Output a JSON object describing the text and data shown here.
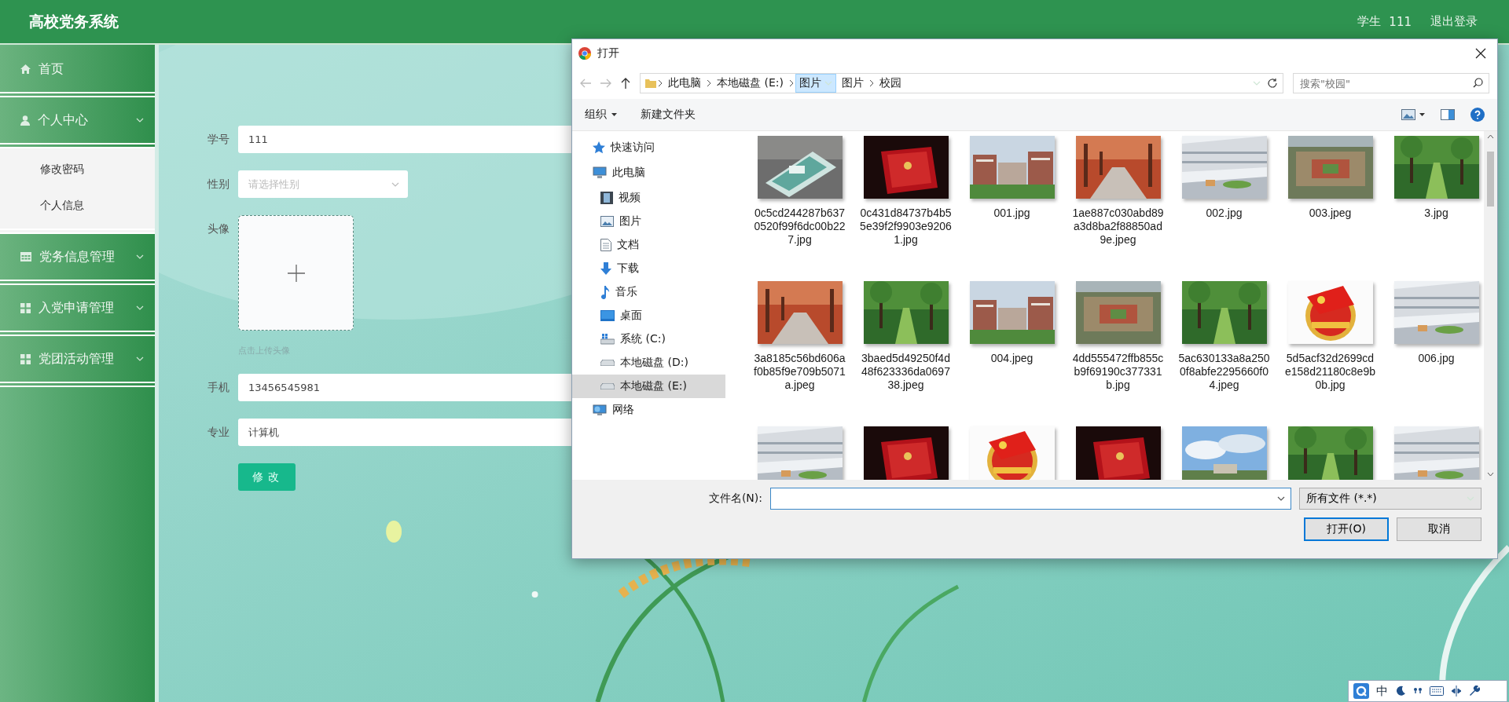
{
  "header": {
    "title": "高校党务系统",
    "role": "学生",
    "username": "111",
    "logout": "退出登录"
  },
  "sidebar": {
    "items": [
      {
        "label": "首页",
        "kind": "home"
      },
      {
        "label": "个人中心",
        "kind": "user",
        "expanded": true,
        "children": [
          {
            "label": "修改密码"
          },
          {
            "label": "个人信息"
          }
        ]
      },
      {
        "label": "党务信息管理",
        "kind": "table"
      },
      {
        "label": "入党申请管理",
        "kind": "grid"
      },
      {
        "label": "党团活动管理",
        "kind": "grid"
      }
    ]
  },
  "form": {
    "fields": [
      {
        "label": "学号",
        "kind": "text",
        "value": "111"
      },
      {
        "label": "性别",
        "kind": "select",
        "placeholder": "请选择性别"
      },
      {
        "label": "头像",
        "kind": "upload",
        "hint": "点击上传头像"
      },
      {
        "label": "手机",
        "kind": "text",
        "value": "13456545981"
      },
      {
        "label": "专业",
        "kind": "text",
        "value": "计算机"
      }
    ],
    "submit": "修改"
  },
  "dialog": {
    "title": "打开",
    "address": [
      {
        "label": "此电脑",
        "selected": false
      },
      {
        "label": "本地磁盘 (E:)",
        "selected": false
      },
      {
        "label": "图片",
        "selected": true
      },
      {
        "label": "图片",
        "selected": false
      },
      {
        "label": "校园",
        "selected": false
      }
    ],
    "search": {
      "placeholder": "搜索\"校园\""
    },
    "toolbar": {
      "organize": "组织",
      "new_folder": "新建文件夹"
    },
    "nav": [
      {
        "label": "快速访问",
        "kind": "star",
        "selected": false
      },
      {
        "label": "此电脑",
        "kind": "pc",
        "selected": false,
        "children": [
          {
            "label": "视频",
            "kind": "video",
            "selected": false
          },
          {
            "label": "图片",
            "kind": "pictures",
            "selected": false
          },
          {
            "label": "文档",
            "kind": "document",
            "selected": false
          },
          {
            "label": "下载",
            "kind": "download",
            "selected": false
          },
          {
            "label": "音乐",
            "kind": "music",
            "selected": false
          },
          {
            "label": "桌面",
            "kind": "desktop",
            "selected": false
          },
          {
            "label": "系统 (C:)",
            "kind": "system",
            "selected": false
          },
          {
            "label": "本地磁盘 (D:)",
            "kind": "drive",
            "selected": false
          },
          {
            "label": "本地磁盘 (E:)",
            "kind": "drive",
            "selected": true
          }
        ]
      },
      {
        "label": "网络",
        "kind": "network",
        "selected": false
      }
    ],
    "files": [
      {
        "name": "0c5cd244287b6370520f99f6dc00b227.jpg",
        "kind": "picture"
      },
      {
        "name": "0c431d84737b4b55e39f2f9903e92061.jpg",
        "kind": "picture"
      },
      {
        "name": "001.jpg",
        "kind": "picture"
      },
      {
        "name": "1ae887c030abd89a3d8ba2f88850ad9e.jpeg",
        "kind": "picture"
      },
      {
        "name": "002.jpg",
        "kind": "picture"
      },
      {
        "name": "003.jpeg",
        "kind": "picture"
      },
      {
        "name": "3.jpg",
        "kind": "picture"
      },
      {
        "name": "3a8185c56bd606af0b85f9e709b5071a.jpeg",
        "kind": "picture"
      },
      {
        "name": "3baed5d49250f4d48f623336da069738.jpeg",
        "kind": "picture"
      },
      {
        "name": "004.jpeg",
        "kind": "picture"
      },
      {
        "name": "4dd555472ffb855cb9f69190c377331b.jpg",
        "kind": "picture"
      },
      {
        "name": "5ac630133a8a2500f8abfe2295660f04.jpeg",
        "kind": "picture"
      },
      {
        "name": "5d5acf32d2699cde158d21180c8e9b0b.jpg",
        "kind": "picture"
      },
      {
        "name": "006.jpg",
        "kind": "picture"
      },
      {
        "kind": "picture"
      },
      {
        "kind": "picture"
      },
      {
        "kind": "picture"
      },
      {
        "kind": "picture"
      },
      {
        "kind": "picture"
      },
      {
        "kind": "picture"
      },
      {
        "kind": "picture"
      }
    ],
    "filename": {
      "label": "文件名(N):"
    },
    "filter": "所有文件 (*.*)",
    "buttons": [
      {
        "label": "打开(O)",
        "kind": "primary"
      },
      {
        "label": "取消",
        "kind": "secondary"
      }
    ]
  },
  "ime_bar": {
    "mode": "中"
  }
}
